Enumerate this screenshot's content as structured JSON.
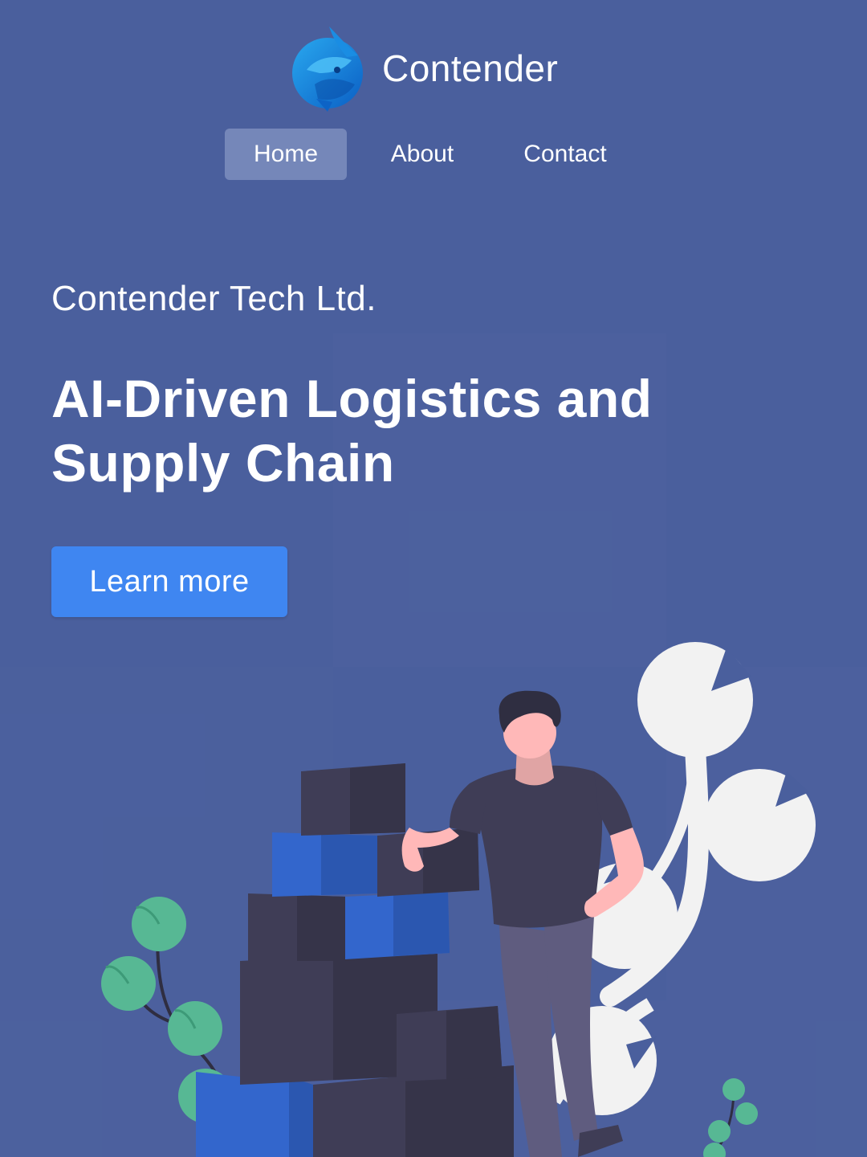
{
  "brand": {
    "name": "Contender",
    "logo_icon": "fish-logo-icon"
  },
  "nav": {
    "items": [
      {
        "label": "Home",
        "active": true
      },
      {
        "label": "About",
        "active": false
      },
      {
        "label": "Contact",
        "active": false
      }
    ]
  },
  "hero": {
    "company": "Contender Tech Ltd.",
    "headline_line1": "AI-Driven Logistics and",
    "headline_line2": "Supply Chain",
    "cta_label": "Learn more"
  },
  "illustration": {
    "icon": "person-with-boxes-illustration"
  },
  "colors": {
    "background": "#4a5f9d",
    "nav_active": "#7587b9",
    "cta": "#3f86f1",
    "box_dark": "#3f3d56",
    "box_blue": "#3366cc",
    "plant_green": "#57b894",
    "leaf_white": "#f2f2f2",
    "skin": "#ffb8b8"
  }
}
